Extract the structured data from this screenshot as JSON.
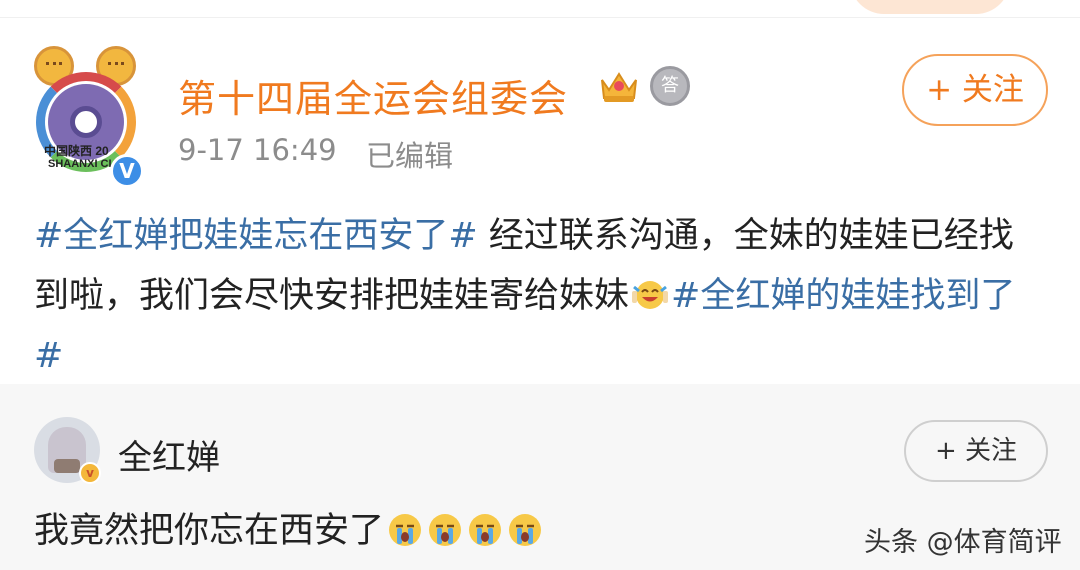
{
  "post": {
    "username": "第十四届全运会组委会",
    "logo_text_line1": "中国陕西 20",
    "logo_text_line2": "SHAANXI CI",
    "timestamp": "9-17 16:49",
    "edited_label": "已编辑",
    "follow_label": "+ 关注",
    "medal_glyph": "答",
    "verified_glyph": "V",
    "body": {
      "hashtag1": "#全红婵把娃娃忘在西安了#",
      "text1": " 经过联系沟通，全妹的娃娃已经找到啦，我们会尽快安排把娃娃寄给妹妹",
      "hashtag2": "#全红婵的娃娃找到了#"
    }
  },
  "comment": {
    "username": "全红婵",
    "follow_label": "+ 关注",
    "text": "我竟然把你忘在西安了",
    "crying_emoji_count": 4
  },
  "watermark": "头条 @体育简评",
  "colors": {
    "username_orange": "#f07a1f",
    "hashtag_blue": "#3a6ea5",
    "meta_gray": "#8c8c8c",
    "comment_bg": "#f7f7f7"
  },
  "icons": [
    "laughing-crying-emoji-icon",
    "crying-emoji-icon",
    "crown-badge-icon",
    "medal-badge-icon",
    "verified-icon"
  ]
}
